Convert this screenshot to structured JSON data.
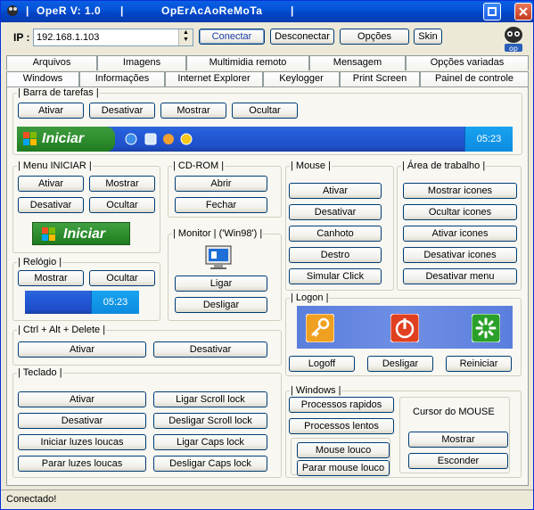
{
  "window": {
    "title_left": "OpeR  V: 1.0",
    "title_right": "OpErAcAoReMoTa",
    "separator": "|"
  },
  "toolbar": {
    "ip_label": "IP :",
    "ip_value": "192.168.1.103",
    "connect": "Conectar",
    "disconnect": "Desconectar",
    "options": "Opções",
    "skin": "Skin"
  },
  "tabs_row1": [
    "Arquivos",
    "Imagens",
    "Multimidia remoto",
    "Mensagem",
    "Opções variadas"
  ],
  "tabs_row2": [
    "Windows",
    "Informações",
    "Internet Explorer",
    "Keylogger",
    "Print Screen",
    "Painel de controle"
  ],
  "active_tab": "Windows",
  "barra_tarefas": {
    "label": "Barra de tarefas",
    "buttons": [
      "Ativar",
      "Desativar",
      "Mostrar",
      "Ocultar"
    ],
    "start_label": "Iniciar",
    "clock": "05:23"
  },
  "menu_iniciar": {
    "label": "Menu INICIAR",
    "buttons": [
      "Ativar",
      "Mostrar",
      "Desativar",
      "Ocultar"
    ],
    "start_label": "Iniciar"
  },
  "relogio": {
    "label": "Relógio",
    "buttons": [
      "Mostrar",
      "Ocultar"
    ],
    "clock": "05:23"
  },
  "cdrom": {
    "label": "CD-ROM",
    "buttons": [
      "Abrir",
      "Fechar"
    ]
  },
  "monitor": {
    "label": "Monitor | ('Win98')",
    "buttons": [
      "Ligar",
      "Desligar"
    ]
  },
  "mouse": {
    "label": "Mouse",
    "buttons": [
      "Ativar",
      "Desativar",
      "Canhoto",
      "Destro",
      "Simular Click"
    ]
  },
  "area_trabalho": {
    "label": "Área de trabalho",
    "buttons": [
      "Mostrar icones",
      "Ocultar icones",
      "Ativar icones",
      "Desativar icones",
      "Desativar menu"
    ]
  },
  "logon": {
    "label": "Logon",
    "buttons": [
      "Logoff",
      "Desligar",
      "Reiniciar"
    ]
  },
  "ctrl_alt_del": {
    "label": "Ctrl + Alt + Delete",
    "buttons": [
      "Ativar",
      "Desativar"
    ]
  },
  "teclado": {
    "label": "Teclado",
    "buttons": [
      "Ativar",
      "Ligar Scroll lock",
      "Desativar",
      "Desligar Scroll lock",
      "Iniciar luzes loucas",
      "Ligar Caps lock",
      "Parar luzes loucas",
      "Desligar Caps lock"
    ]
  },
  "windows_group": {
    "label": "Windows",
    "buttons": [
      "Processos rapidos",
      "Processos lentos",
      "Mouse louco",
      "Parar mouse louco"
    ],
    "cursor_label": "Cursor do MOUSE",
    "cursor_buttons": [
      "Mostrar",
      "Esconder"
    ]
  },
  "status": {
    "text": "Conectado!"
  },
  "colors": {
    "title_blue": "#0453d8",
    "start_green": "#2f8f2f",
    "taskbar_blue": "#245edb",
    "window_bg": "#ece9d8"
  }
}
